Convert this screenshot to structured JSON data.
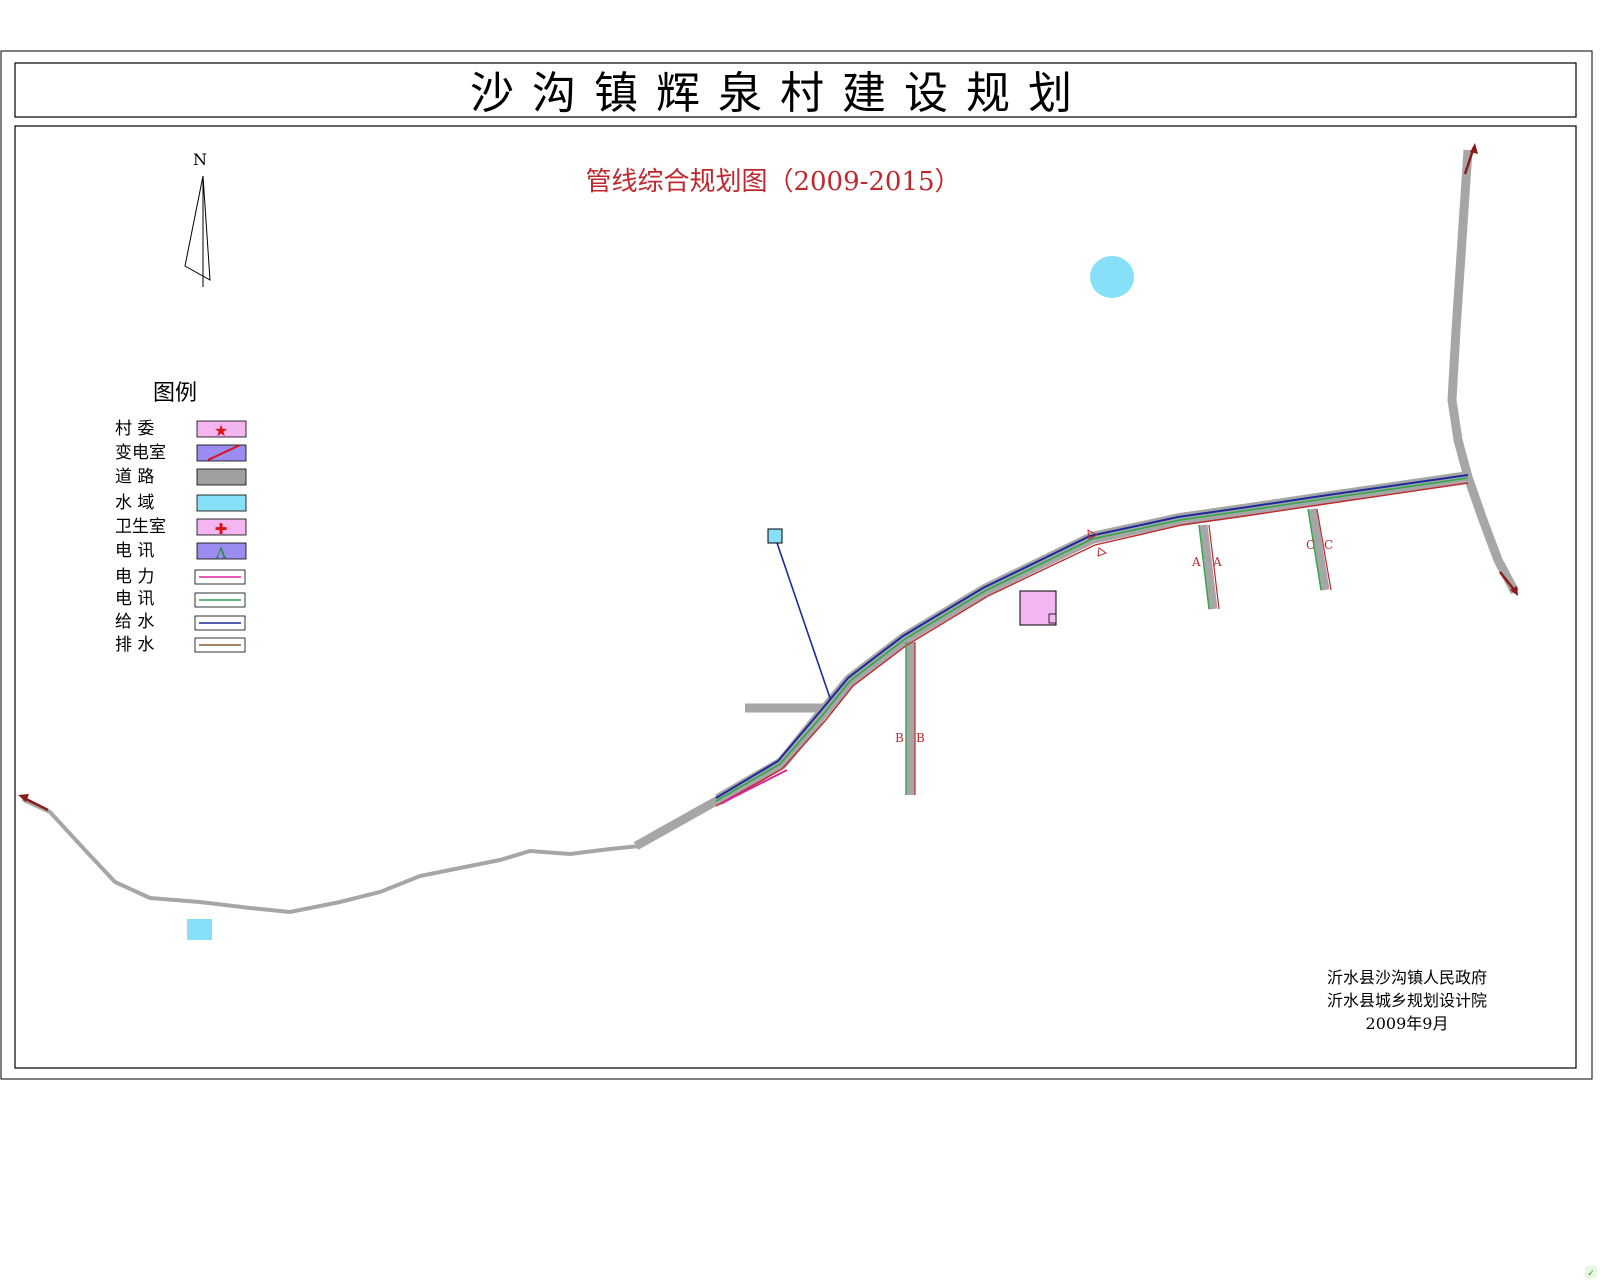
{
  "title": "沙沟镇辉泉村建设规划",
  "subtitle": "管线综合规划图（2009-2015）",
  "north_label": "N",
  "legend": {
    "heading": "图例",
    "items": [
      {
        "label": "村 委",
        "icon": "village-committee-star-icon",
        "fill": "#f4b6f0"
      },
      {
        "label": "变电室",
        "icon": "substation-slash-icon",
        "fill": "#9b8cf0"
      },
      {
        "label": "道 路",
        "icon": "road-swatch",
        "fill": "#a0a0a0"
      },
      {
        "label": "水 域",
        "icon": "water-swatch",
        "fill": "#86e0f7"
      },
      {
        "label": "卫生室",
        "icon": "clinic-cross-icon",
        "fill": "#f4b6f0"
      },
      {
        "label": "电 讯",
        "icon": "telecom-station-icon",
        "fill": "#9b8cf0"
      },
      {
        "label": "电 力",
        "icon": "power-line-swatch",
        "fill": "#ffffff"
      },
      {
        "label": "电 讯",
        "icon": "telecom-line-swatch",
        "fill": "#ffffff"
      },
      {
        "label": "给 水",
        "icon": "water-supply-line-swatch",
        "fill": "#ffffff"
      },
      {
        "label": "排 水",
        "icon": "drainage-line-swatch",
        "fill": "#ffffff"
      }
    ]
  },
  "section_marks": [
    "A",
    "A",
    "B",
    "B",
    "C",
    "C"
  ],
  "credits": {
    "line1": "沂水县沙沟镇人民政府",
    "line2": "沂水县城乡规划设计院",
    "date": "2009年9月"
  },
  "colors": {
    "road": "#a6a6a6",
    "water": "#86e0f7",
    "power": "#e0229a",
    "telecom": "#2fa84a",
    "water_supply": "#1c2a9b",
    "drainage": "#c0282d",
    "title_red": "#c0282d"
  }
}
